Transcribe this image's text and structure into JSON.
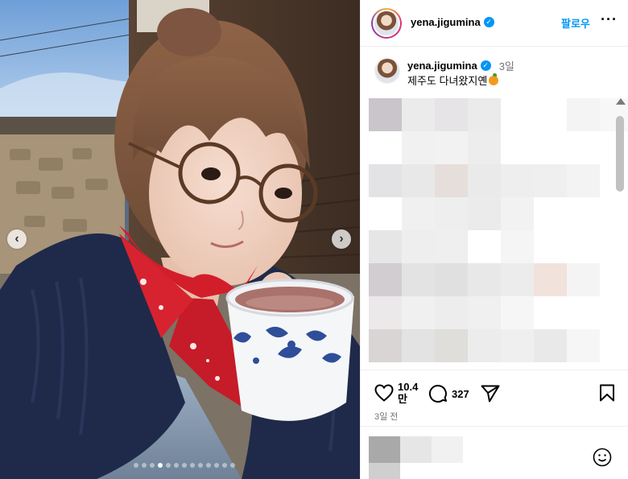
{
  "post": {
    "username": "yena.jigumina",
    "follow_label": "팔로우",
    "more_label": "···",
    "verified_mark": "✓",
    "caption_text": "제주도 다녀왔지옌",
    "caption_emoji": "tangerine-icon",
    "caption_time": "3일",
    "likes": "10.4만",
    "comments": "327",
    "date": "3일 전"
  },
  "carousel": {
    "prev_label": "‹",
    "next_label": "›",
    "slide_count": 13,
    "active_index": 3
  },
  "colors": {
    "accent": "#0095f6",
    "text_secondary": "#737373",
    "divider": "#efefef"
  },
  "icons": {
    "like": "heart-icon",
    "comment": "speech-bubble-icon",
    "share": "paper-plane-icon",
    "save": "bookmark-icon",
    "emoji": "smiley-icon",
    "scroll_up": "scroll-up-arrow-icon",
    "scroll_down": "scroll-down-arrow-icon"
  }
}
